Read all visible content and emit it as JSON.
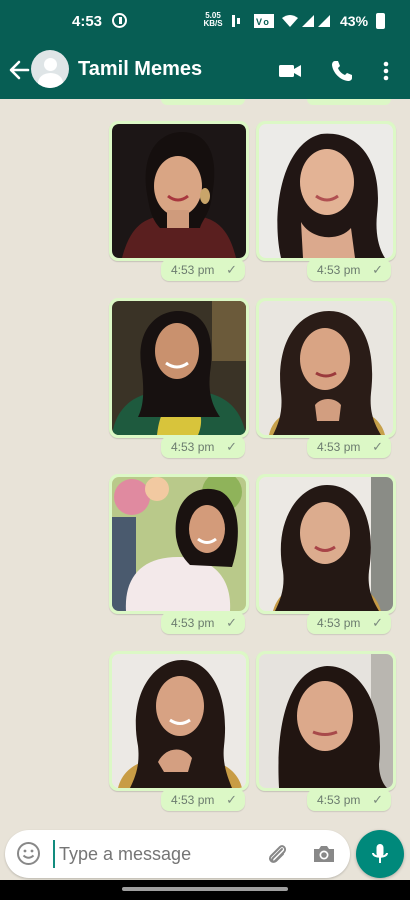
{
  "status_bar": {
    "time": "4:53",
    "net_speed_value": "5.05",
    "net_speed_unit": "KB/S",
    "battery": "43%"
  },
  "header": {
    "title": "Tamil Memes"
  },
  "messages": [
    {
      "time": "4:53 pm",
      "tick": "✓"
    },
    {
      "time": "4:53 pm",
      "tick": "✓"
    },
    {
      "time": "4:53 pm",
      "tick": "✓"
    },
    {
      "time": "4:53 pm",
      "tick": "✓"
    },
    {
      "time": "4:53 pm",
      "tick": "✓"
    },
    {
      "time": "4:53 pm",
      "tick": "✓"
    },
    {
      "time": "4:53 pm",
      "tick": "✓"
    },
    {
      "time": "4:53 pm",
      "tick": "✓"
    }
  ],
  "input": {
    "placeholder": "Type a message"
  },
  "colors": {
    "header": "#075e54",
    "bubble": "#dcf8c6",
    "fab": "#00897b"
  }
}
